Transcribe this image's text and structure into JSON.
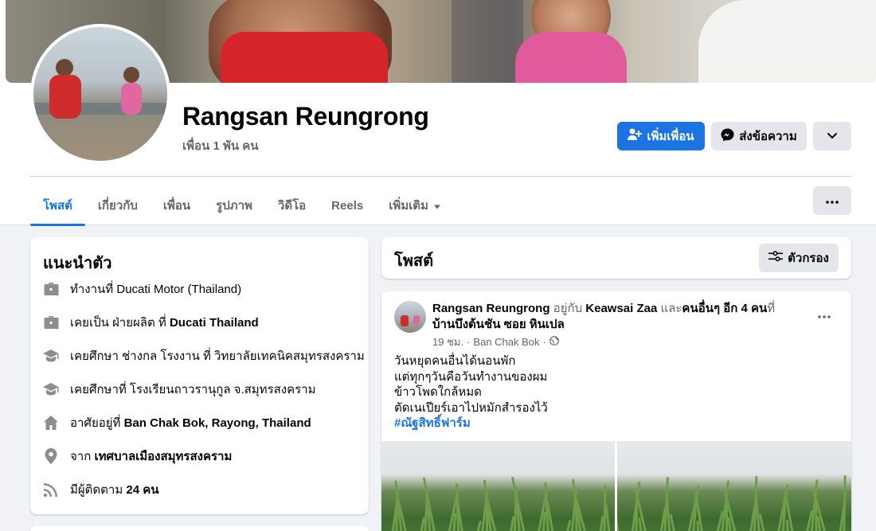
{
  "profile": {
    "name": "Rangsan Reungrong",
    "friend_count": "เพื่อน 1 พัน คน",
    "add_friend_label": "เพิ่มเพื่อน",
    "message_label": "ส่งข้อความ"
  },
  "tabs": [
    {
      "label": "โพสต์",
      "active": true
    },
    {
      "label": "เกี่ยวกับ"
    },
    {
      "label": "เพื่อน"
    },
    {
      "label": "รูปภาพ"
    },
    {
      "label": "วิดีโอ"
    },
    {
      "label": "Reels"
    },
    {
      "label": "เพิ่มเติม"
    }
  ],
  "intro": {
    "title": "แนะนำตัว",
    "items": [
      {
        "icon": "briefcase-icon",
        "prefix": "ทำงานที่ Ducati Motor (Thailand)",
        "bold": ""
      },
      {
        "icon": "briefcase-icon",
        "prefix": "เคยเป็น ฝ่ายผลิต ที่ ",
        "bold": "Ducati Thailand"
      },
      {
        "icon": "graduation-cap-icon",
        "prefix": "เคยศึกษา ช่างกล โรงงาน ที่ วิทยาลัยเทคนิคสมุทรสงคราม",
        "bold": ""
      },
      {
        "icon": "graduation-cap-icon",
        "prefix": "เคยศึกษาที่ โรงเรียนถาวรานุกูล จ.สมุทรสงคราม",
        "bold": ""
      },
      {
        "icon": "home-icon",
        "prefix": "อาศัยอยู่ที่ ",
        "bold": "Ban Chak Bok, Rayong, Thailand"
      },
      {
        "icon": "location-pin-icon",
        "prefix": "จาก ",
        "bold": "เทศบาลเมืองสมุทรสงคราม"
      },
      {
        "icon": "rss-feed-icon",
        "prefix": "มีผู้ติดตาม ",
        "bold": "24 คน"
      }
    ]
  },
  "posts": {
    "title": "โพสต์",
    "filter_label": "ตัวกรอง"
  },
  "post": {
    "author": "Rangsan Reungrong",
    "with_text": " อยู่กับ ",
    "tagged": "Keawsai Zaa",
    "and_text": " และ",
    "others": "คนอื่นๆ อีก 4 คน",
    "at_text": "ที่ ",
    "place": "บ้านบึงต้นชัน ซอย หินเปล",
    "time": "19 ชม.",
    "location": "Ban Chak Bok",
    "privacy_icon": "globe-icon",
    "lines": [
      "วันหยุดคนอื่นได้นอนพัก",
      "แต่ทุกๆวันคือวันทำงานของผม",
      "ข้าวโพดใกล้หมด",
      "ตัดเนเปียร์เอาไปหมักสำรองไว้"
    ],
    "hashtag": "#ณัฐสิทธิ์ฟาร์ม"
  },
  "colors": {
    "accent": "#1b74e4",
    "secondary_text": "#65676b",
    "page_bg": "#f0f2f5",
    "button_gray": "#e4e6eb"
  }
}
